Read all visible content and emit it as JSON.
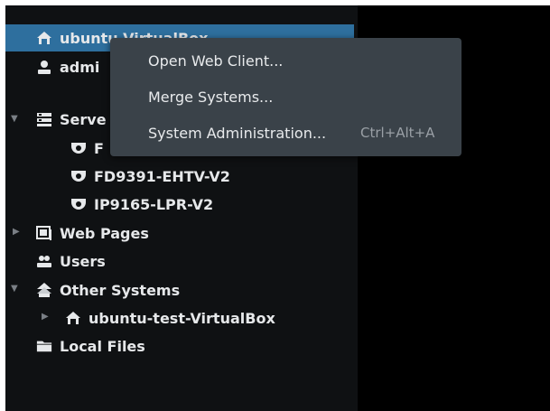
{
  "tree": {
    "selected_item": "ubuntu-VirtualBox",
    "admin_item": "admi",
    "servers_label": "Serve",
    "server_children": [
      "F",
      "FD9391-EHTV-V2",
      "IP9165-LPR-V2"
    ],
    "web_pages": "Web Pages",
    "users": "Users",
    "other_systems": "Other Systems",
    "other_child": "ubuntu-test-VirtualBox",
    "local_files": "Local Files"
  },
  "menu": {
    "items": [
      {
        "label": "Open Web Client..."
      },
      {
        "label": "Merge Systems..."
      },
      {
        "label": "System Administration...",
        "shortcut": "Ctrl+Alt+A"
      }
    ]
  },
  "colors": {
    "selection": "#2e6f9e",
    "menu_bg": "#3a4249",
    "panel_bg": "#0f1113"
  },
  "icons": [
    "home-icon",
    "user-icon",
    "server-group-icon",
    "camera-icon",
    "web-page-icon",
    "users-icon",
    "other-systems-icon",
    "folder-icon",
    "expand-arrow-icon"
  ]
}
